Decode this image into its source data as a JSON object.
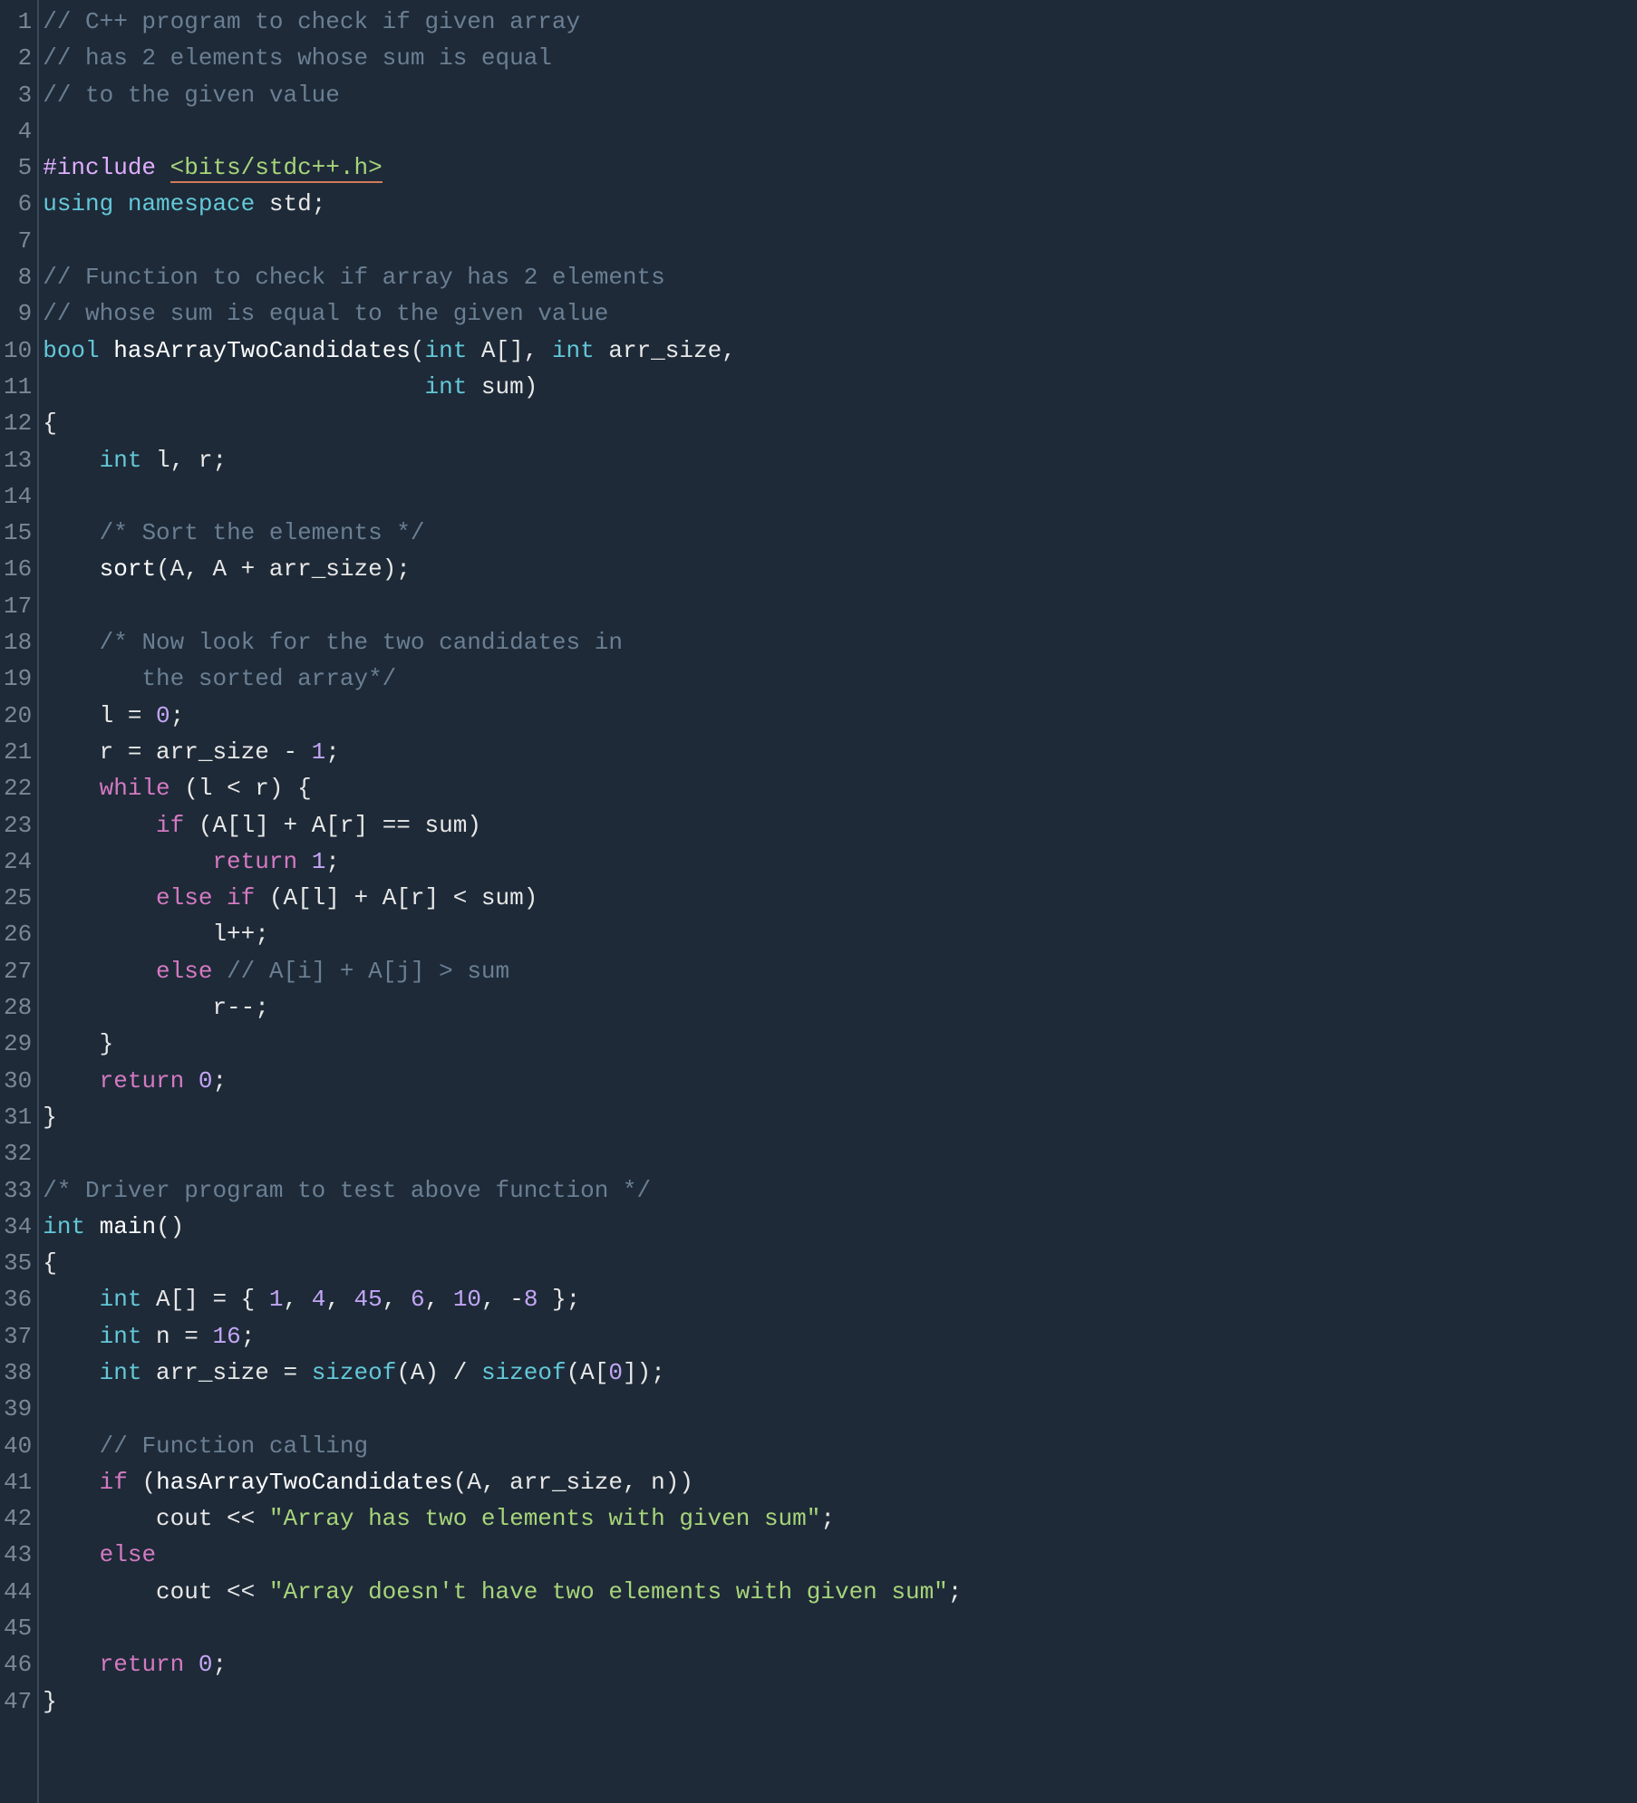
{
  "lines": [
    {
      "n": 1,
      "tokens": [
        {
          "t": "// C++ program to check if given array",
          "c": "c-comment"
        }
      ]
    },
    {
      "n": 2,
      "tokens": [
        {
          "t": "// has 2 elements whose sum is equal",
          "c": "c-comment"
        }
      ]
    },
    {
      "n": 3,
      "tokens": [
        {
          "t": "// to the given value",
          "c": "c-comment"
        }
      ]
    },
    {
      "n": 4,
      "tokens": []
    },
    {
      "n": 5,
      "tokens": [
        {
          "t": "#include ",
          "c": "c-preproc"
        },
        {
          "t": "<bits/stdc++.h>",
          "c": "c-include-path"
        }
      ]
    },
    {
      "n": 6,
      "tokens": [
        {
          "t": "using",
          "c": "c-keyword"
        },
        {
          "t": " ",
          "c": "c-id"
        },
        {
          "t": "namespace",
          "c": "c-keyword"
        },
        {
          "t": " std;",
          "c": "c-id"
        }
      ]
    },
    {
      "n": 7,
      "tokens": []
    },
    {
      "n": 8,
      "tokens": [
        {
          "t": "// Function to check if array has 2 elements",
          "c": "c-comment"
        }
      ]
    },
    {
      "n": 9,
      "tokens": [
        {
          "t": "// whose sum is equal to the given value",
          "c": "c-comment"
        }
      ]
    },
    {
      "n": 10,
      "tokens": [
        {
          "t": "bool",
          "c": "c-keyword"
        },
        {
          "t": " ",
          "c": "c-id"
        },
        {
          "t": "hasArrayTwoCandidates",
          "c": "c-func"
        },
        {
          "t": "(",
          "c": "c-paren"
        },
        {
          "t": "int",
          "c": "c-keyword"
        },
        {
          "t": " A[], ",
          "c": "c-id"
        },
        {
          "t": "int",
          "c": "c-keyword"
        },
        {
          "t": " arr_size,",
          "c": "c-id"
        }
      ]
    },
    {
      "n": 11,
      "tokens": [
        {
          "t": "                           ",
          "c": "c-id"
        },
        {
          "t": "int",
          "c": "c-keyword"
        },
        {
          "t": " sum)",
          "c": "c-id"
        }
      ]
    },
    {
      "n": 12,
      "tokens": [
        {
          "t": "{",
          "c": "c-paren"
        }
      ]
    },
    {
      "n": 13,
      "tokens": [
        {
          "t": "    ",
          "c": "c-id"
        },
        {
          "t": "int",
          "c": "c-keyword"
        },
        {
          "t": " l, r;",
          "c": "c-id"
        }
      ]
    },
    {
      "n": 14,
      "tokens": []
    },
    {
      "n": 15,
      "tokens": [
        {
          "t": "    ",
          "c": "c-id"
        },
        {
          "t": "/* Sort the elements */",
          "c": "c-comment"
        }
      ]
    },
    {
      "n": 16,
      "tokens": [
        {
          "t": "    ",
          "c": "c-id"
        },
        {
          "t": "sort",
          "c": "c-func"
        },
        {
          "t": "(A, A + arr_size);",
          "c": "c-id"
        }
      ]
    },
    {
      "n": 17,
      "tokens": []
    },
    {
      "n": 18,
      "tokens": [
        {
          "t": "    ",
          "c": "c-id"
        },
        {
          "t": "/* Now look for the two candidates in",
          "c": "c-comment"
        }
      ]
    },
    {
      "n": 19,
      "tokens": [
        {
          "t": "       the sorted array*/",
          "c": "c-comment"
        }
      ]
    },
    {
      "n": 20,
      "tokens": [
        {
          "t": "    l = ",
          "c": "c-id"
        },
        {
          "t": "0",
          "c": "c-number"
        },
        {
          "t": ";",
          "c": "c-id"
        }
      ]
    },
    {
      "n": 21,
      "tokens": [
        {
          "t": "    r = arr_size - ",
          "c": "c-id"
        },
        {
          "t": "1",
          "c": "c-number"
        },
        {
          "t": ";",
          "c": "c-id"
        }
      ]
    },
    {
      "n": 22,
      "tokens": [
        {
          "t": "    ",
          "c": "c-id"
        },
        {
          "t": "while",
          "c": "c-ctrl"
        },
        {
          "t": " (l < r) {",
          "c": "c-id"
        }
      ]
    },
    {
      "n": 23,
      "tokens": [
        {
          "t": "        ",
          "c": "c-id"
        },
        {
          "t": "if",
          "c": "c-ctrl"
        },
        {
          "t": " (A[l] + A[r] == sum)",
          "c": "c-id"
        }
      ]
    },
    {
      "n": 24,
      "tokens": [
        {
          "t": "            ",
          "c": "c-id"
        },
        {
          "t": "return",
          "c": "c-ctrl"
        },
        {
          "t": " ",
          "c": "c-id"
        },
        {
          "t": "1",
          "c": "c-number"
        },
        {
          "t": ";",
          "c": "c-id"
        }
      ]
    },
    {
      "n": 25,
      "tokens": [
        {
          "t": "        ",
          "c": "c-id"
        },
        {
          "t": "else if",
          "c": "c-ctrl"
        },
        {
          "t": " (A[l] + A[r] < sum)",
          "c": "c-id"
        }
      ]
    },
    {
      "n": 26,
      "tokens": [
        {
          "t": "            l++;",
          "c": "c-id"
        }
      ]
    },
    {
      "n": 27,
      "tokens": [
        {
          "t": "        ",
          "c": "c-id"
        },
        {
          "t": "else",
          "c": "c-ctrl"
        },
        {
          "t": " ",
          "c": "c-id"
        },
        {
          "t": "// A[i] + A[j] > sum",
          "c": "c-comment"
        }
      ]
    },
    {
      "n": 28,
      "tokens": [
        {
          "t": "            r--;",
          "c": "c-id"
        }
      ]
    },
    {
      "n": 29,
      "tokens": [
        {
          "t": "    }",
          "c": "c-id"
        }
      ]
    },
    {
      "n": 30,
      "tokens": [
        {
          "t": "    ",
          "c": "c-id"
        },
        {
          "t": "return",
          "c": "c-ctrl"
        },
        {
          "t": " ",
          "c": "c-id"
        },
        {
          "t": "0",
          "c": "c-number"
        },
        {
          "t": ";",
          "c": "c-id"
        }
      ]
    },
    {
      "n": 31,
      "tokens": [
        {
          "t": "}",
          "c": "c-paren"
        }
      ]
    },
    {
      "n": 32,
      "tokens": []
    },
    {
      "n": 33,
      "tokens": [
        {
          "t": "/* Driver program to test above function */",
          "c": "c-comment"
        }
      ]
    },
    {
      "n": 34,
      "tokens": [
        {
          "t": "int",
          "c": "c-keyword"
        },
        {
          "t": " ",
          "c": "c-id"
        },
        {
          "t": "main",
          "c": "c-func"
        },
        {
          "t": "()",
          "c": "c-paren"
        }
      ]
    },
    {
      "n": 35,
      "tokens": [
        {
          "t": "{",
          "c": "c-paren"
        }
      ]
    },
    {
      "n": 36,
      "tokens": [
        {
          "t": "    ",
          "c": "c-id"
        },
        {
          "t": "int",
          "c": "c-keyword"
        },
        {
          "t": " A[] = { ",
          "c": "c-id"
        },
        {
          "t": "1",
          "c": "c-number"
        },
        {
          "t": ", ",
          "c": "c-id"
        },
        {
          "t": "4",
          "c": "c-number"
        },
        {
          "t": ", ",
          "c": "c-id"
        },
        {
          "t": "45",
          "c": "c-number"
        },
        {
          "t": ", ",
          "c": "c-id"
        },
        {
          "t": "6",
          "c": "c-number"
        },
        {
          "t": ", ",
          "c": "c-id"
        },
        {
          "t": "10",
          "c": "c-number"
        },
        {
          "t": ", -",
          "c": "c-id"
        },
        {
          "t": "8",
          "c": "c-number"
        },
        {
          "t": " };",
          "c": "c-id"
        }
      ]
    },
    {
      "n": 37,
      "tokens": [
        {
          "t": "    ",
          "c": "c-id"
        },
        {
          "t": "int",
          "c": "c-keyword"
        },
        {
          "t": " n = ",
          "c": "c-id"
        },
        {
          "t": "16",
          "c": "c-number"
        },
        {
          "t": ";",
          "c": "c-id"
        }
      ]
    },
    {
      "n": 38,
      "tokens": [
        {
          "t": "    ",
          "c": "c-id"
        },
        {
          "t": "int",
          "c": "c-keyword"
        },
        {
          "t": " arr_size = ",
          "c": "c-id"
        },
        {
          "t": "sizeof",
          "c": "c-keyword"
        },
        {
          "t": "(A) / ",
          "c": "c-id"
        },
        {
          "t": "sizeof",
          "c": "c-keyword"
        },
        {
          "t": "(A[",
          "c": "c-id"
        },
        {
          "t": "0",
          "c": "c-number"
        },
        {
          "t": "]);",
          "c": "c-id"
        }
      ]
    },
    {
      "n": 39,
      "tokens": []
    },
    {
      "n": 40,
      "tokens": [
        {
          "t": "    ",
          "c": "c-id"
        },
        {
          "t": "// Function calling",
          "c": "c-comment"
        }
      ]
    },
    {
      "n": 41,
      "tokens": [
        {
          "t": "    ",
          "c": "c-id"
        },
        {
          "t": "if",
          "c": "c-ctrl"
        },
        {
          "t": " (",
          "c": "c-id"
        },
        {
          "t": "hasArrayTwoCandidates",
          "c": "c-func"
        },
        {
          "t": "(A, arr_size, n))",
          "c": "c-id"
        }
      ]
    },
    {
      "n": 42,
      "tokens": [
        {
          "t": "        cout << ",
          "c": "c-id"
        },
        {
          "t": "\"Array has two elements with given sum\"",
          "c": "c-string"
        },
        {
          "t": ";",
          "c": "c-id"
        }
      ]
    },
    {
      "n": 43,
      "tokens": [
        {
          "t": "    ",
          "c": "c-id"
        },
        {
          "t": "else",
          "c": "c-ctrl"
        }
      ]
    },
    {
      "n": 44,
      "tokens": [
        {
          "t": "        cout << ",
          "c": "c-id"
        },
        {
          "t": "\"Array doesn't have two elements with given sum\"",
          "c": "c-string"
        },
        {
          "t": ";",
          "c": "c-id"
        }
      ]
    },
    {
      "n": 45,
      "tokens": []
    },
    {
      "n": 46,
      "tokens": [
        {
          "t": "    ",
          "c": "c-id"
        },
        {
          "t": "return",
          "c": "c-ctrl"
        },
        {
          "t": " ",
          "c": "c-id"
        },
        {
          "t": "0",
          "c": "c-number"
        },
        {
          "t": ";",
          "c": "c-id"
        }
      ]
    },
    {
      "n": 47,
      "tokens": [
        {
          "t": "}",
          "c": "c-paren"
        }
      ]
    }
  ]
}
